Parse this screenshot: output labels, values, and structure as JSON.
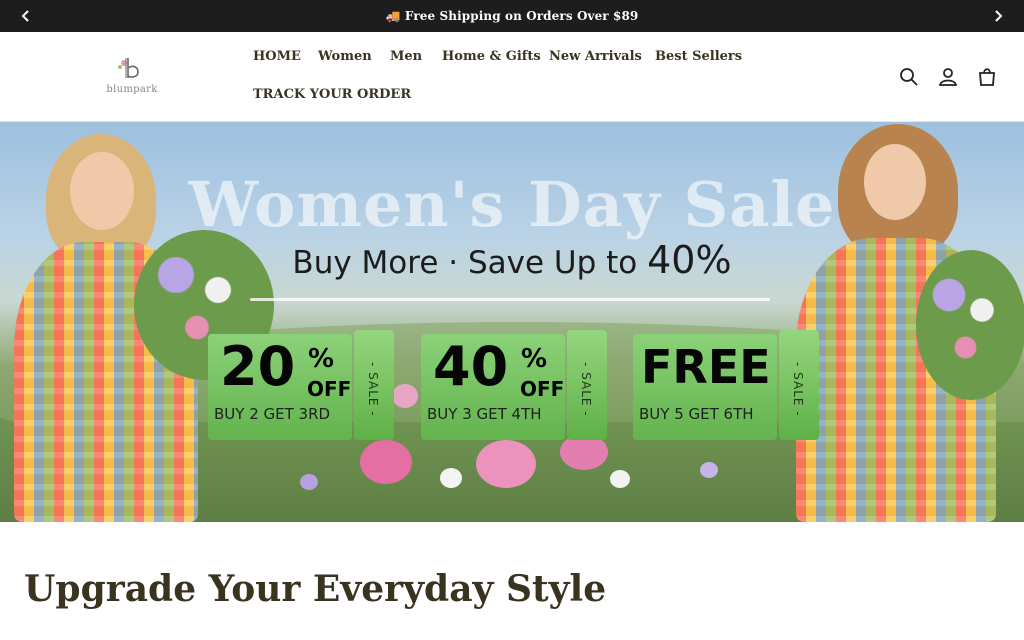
{
  "announcement": {
    "text": "🚚 Free Shipping on Orders Over $89",
    "prev_icon": "chevron-left-icon",
    "next_icon": "chevron-right-icon",
    "background": "#1d1d1d"
  },
  "header": {
    "logo_text": "blumpark",
    "nav": [
      "HOME",
      "Women",
      "Men",
      "Home & Gifts",
      "New Arrivals",
      "Best Sellers",
      "TRACK YOUR ORDER"
    ],
    "icons": [
      "search-icon",
      "account-icon",
      "cart-icon"
    ]
  },
  "hero": {
    "title": "Women's Day Sale",
    "headline": "Buy More · Save Up to ",
    "headline_pct": "40%",
    "offers": [
      {
        "big": "20",
        "pct": "%",
        "off": "OFF",
        "sub": "BUY 2 GET 3RD",
        "tag": "- SALE -"
      },
      {
        "big": "40",
        "pct": "%",
        "off": "OFF",
        "sub": "BUY 3 GET 4TH",
        "tag": "- SALE -"
      },
      {
        "big": "FREE",
        "pct": "",
        "off": "",
        "sub": "BUY 5 GET 6TH",
        "tag": "- SALE -"
      }
    ]
  },
  "section": {
    "title": "Upgrade Your Everyday Style"
  },
  "colors": {
    "text": "#3a3320",
    "offer_green": "#63b34e"
  }
}
